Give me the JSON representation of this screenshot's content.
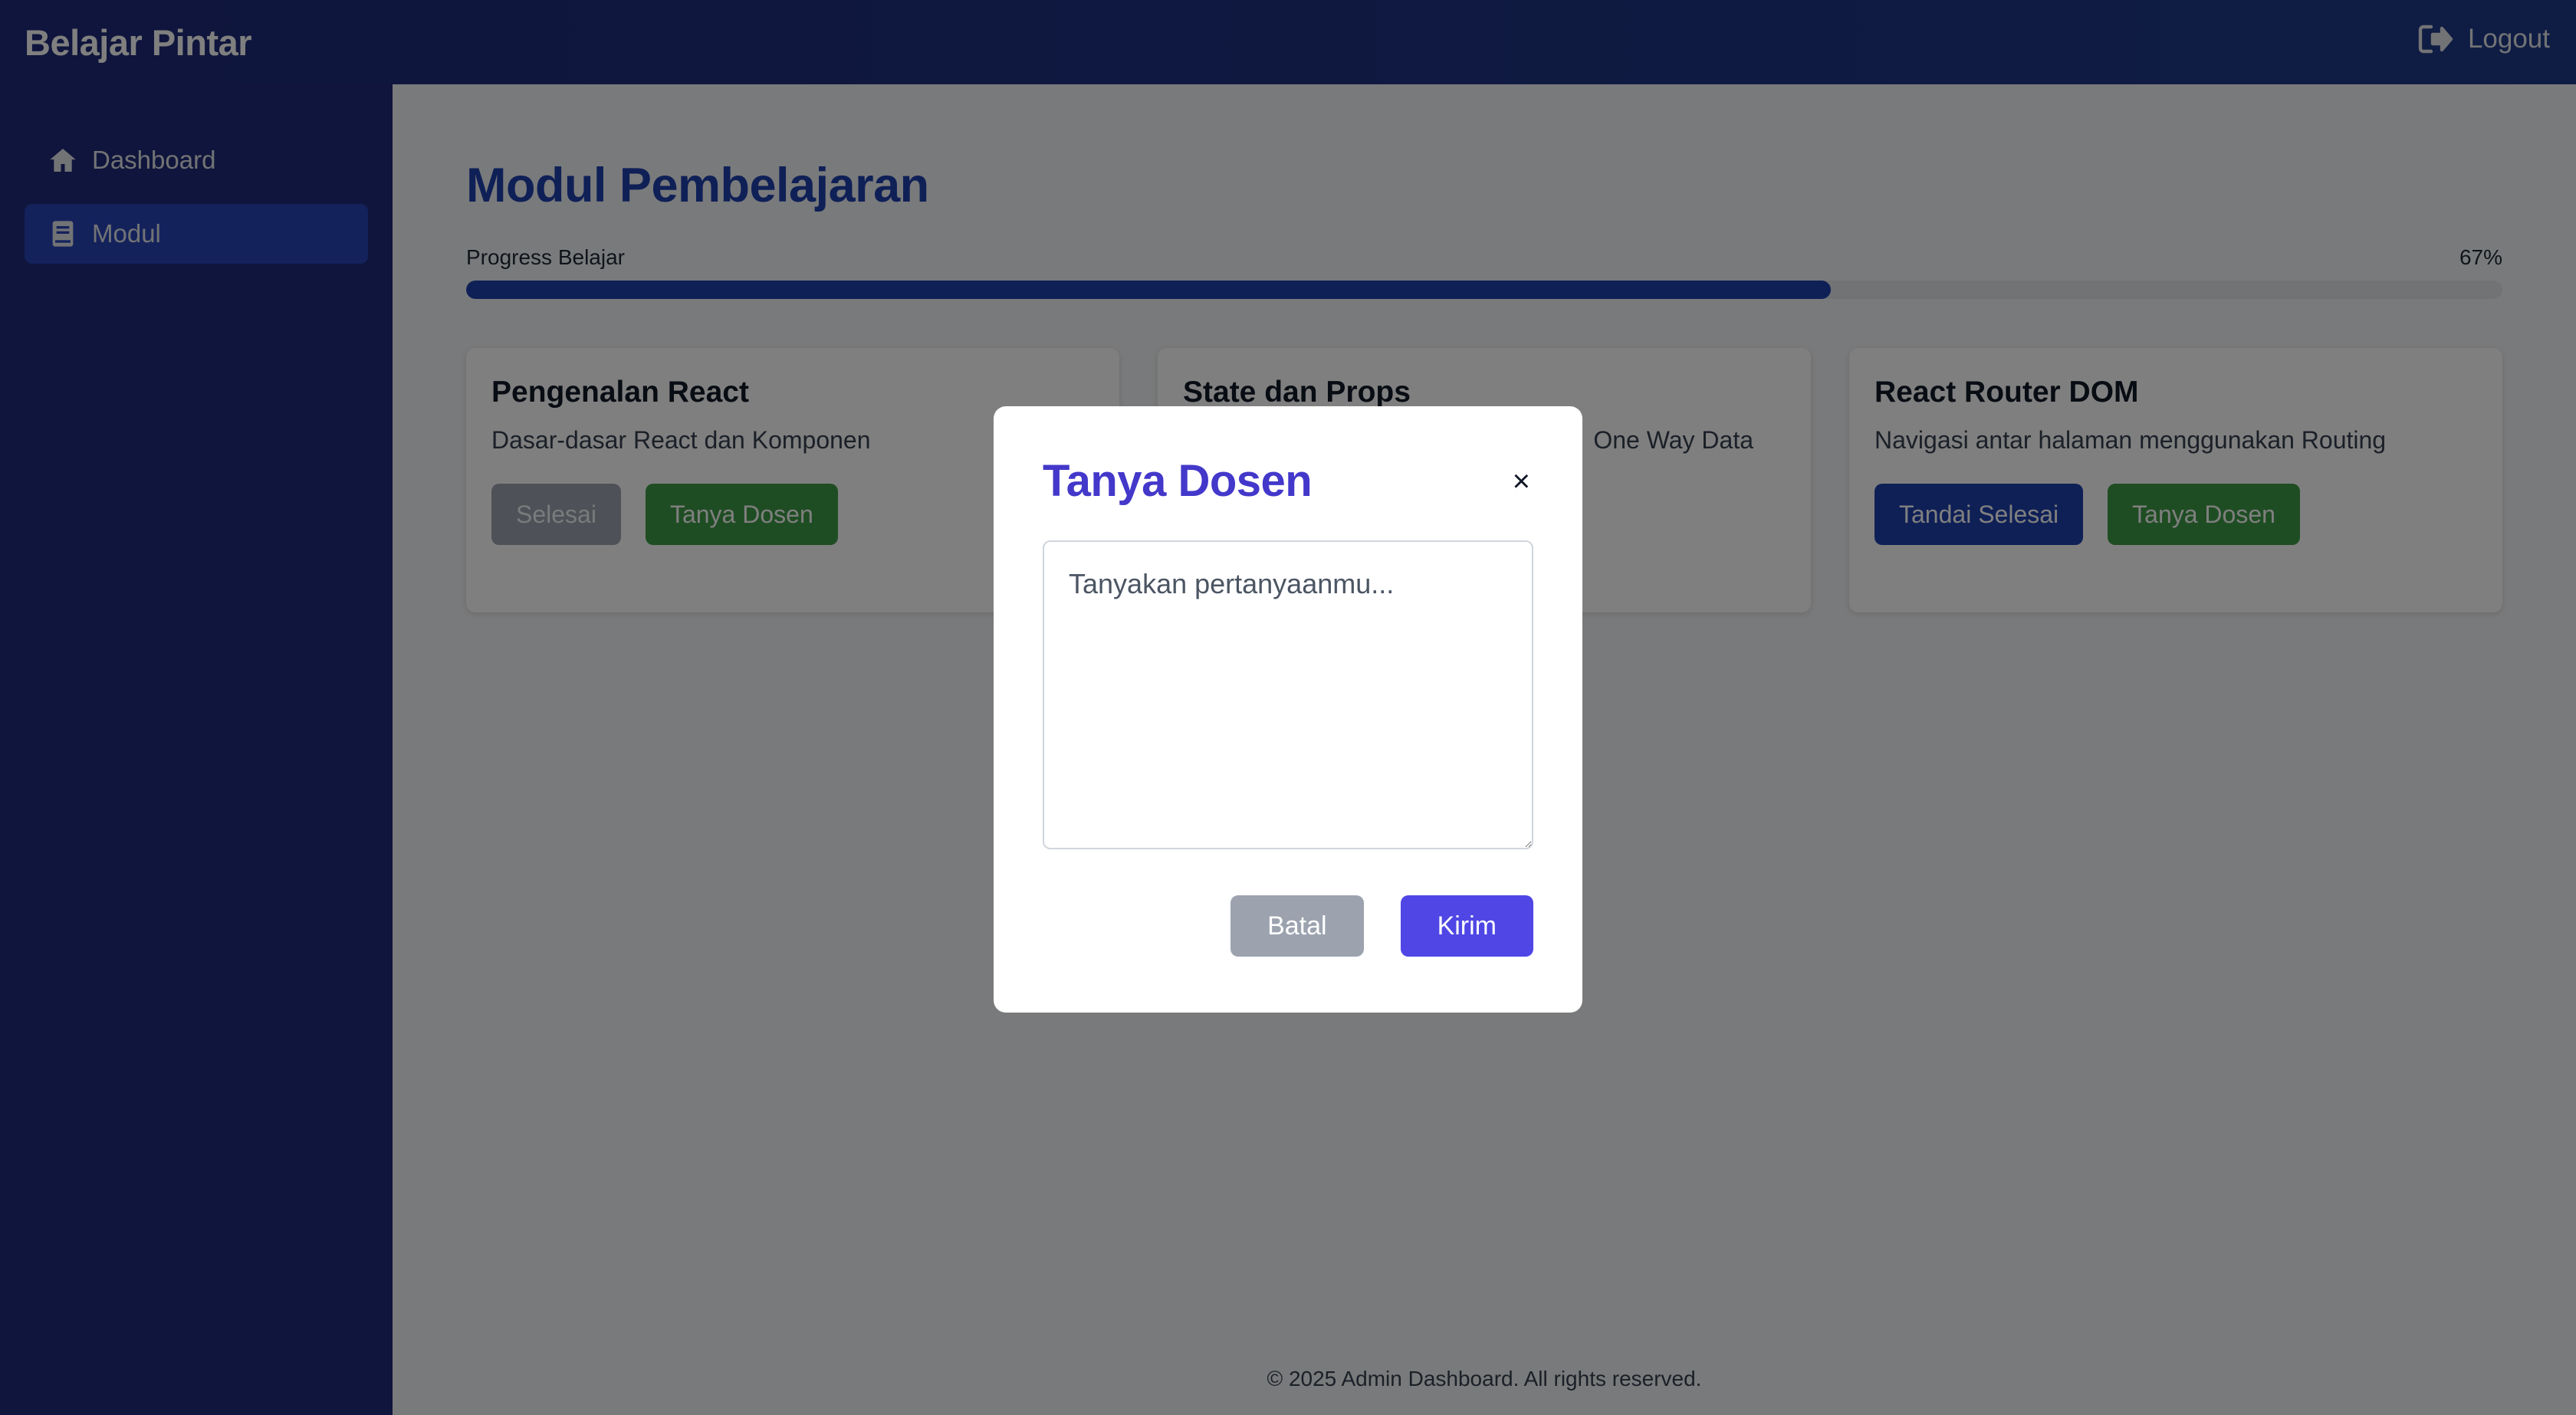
{
  "header": {
    "brand": "Belajar Pintar",
    "logout_label": "Logout",
    "logout_icon": "sign-out-icon"
  },
  "sidebar": {
    "items": [
      {
        "label": "Dashboard",
        "icon": "home-icon",
        "active": false
      },
      {
        "label": "Modul",
        "icon": "book-icon",
        "active": true
      }
    ]
  },
  "main": {
    "title": "Modul Pembelajaran",
    "progress": {
      "label": "Progress Belajar",
      "value_text": "67%",
      "fraction": 0.67
    },
    "cards": [
      {
        "title": "Pengenalan React",
        "description": "Dasar-dasar React dan Komponen",
        "primary_label": "Selesai",
        "secondary_label": "Tanya Dosen"
      },
      {
        "title": "State dan Props",
        "description": "One Way Data",
        "primary_label": "",
        "secondary_label": ""
      },
      {
        "title": "React Router DOM",
        "description": "Navigasi antar halaman menggunakan Routing",
        "primary_label": "Tandai Selesai",
        "secondary_label": "Tanya Dosen"
      }
    ]
  },
  "footer": {
    "text": "© 2025 Admin Dashboard. All rights reserved."
  },
  "modal": {
    "title": "Tanya Dosen",
    "close_symbol": "×",
    "textarea_placeholder": "Tanyakan pertanyaanmu...",
    "cancel_label": "Batal",
    "send_label": "Kirim"
  },
  "colors": {
    "header_bg": "#1e3a8a",
    "sidebar_bg": "#1e2a78",
    "accent_blue": "#1e40af",
    "green": "#3f9a47",
    "modal_accent": "#4f46e5"
  }
}
